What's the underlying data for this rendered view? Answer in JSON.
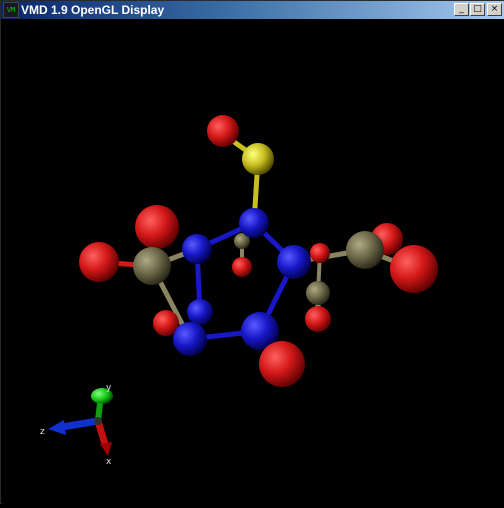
{
  "window": {
    "title": "VMD 1.9 OpenGL Display",
    "icon": "vmd-app-icon",
    "buttons": [
      {
        "name": "minimize-button",
        "glyph": "_"
      },
      {
        "name": "maximize-button",
        "glyph": "□"
      },
      {
        "name": "close-button",
        "glyph": "×"
      }
    ]
  },
  "viewer": {
    "background": "#000000",
    "axes": {
      "x": "x",
      "y": "y",
      "z": "z"
    },
    "colors": {
      "oxygen": "#d41818",
      "nitrogen": "#1818c8",
      "carbon": "#6e6a4a",
      "sulfur": "#c8c020",
      "x_axis": "#c01010",
      "y_axis": "#10c010",
      "z_axis": "#1030d0"
    }
  }
}
